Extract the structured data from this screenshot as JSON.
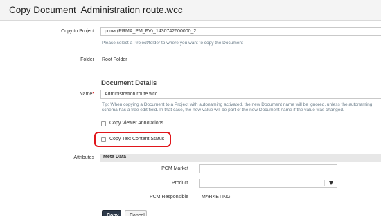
{
  "dialog": {
    "title": "Copy Document  Administration route.wcc"
  },
  "copy_to_project": {
    "label": "Copy to Project",
    "value": "prma (PRMA_PM_FV)_1430742600000_2",
    "hint": "Please select a Project/folder to where you want to copy the Document"
  },
  "folder": {
    "label": "Folder",
    "value": "Root Folder"
  },
  "document_details": {
    "title": "Document Details",
    "name_label": "Name",
    "required_mark": "*",
    "name_value": "Administration route.wcc",
    "tip_line1": "Tip: When copying a Document to a Project with autonaming activated, the new Document name will be ignored, unless the autonaming",
    "tip_line2": "schema has a free edit field. In that case, the new value will be part of the new Document name if the value was changed."
  },
  "options": {
    "copy_viewer_annotations": "Copy Viewer Annotations",
    "copy_text_content_status": "Copy Text Content Status"
  },
  "attributes": {
    "label": "Attributes",
    "meta_header": "Meta Data",
    "pcm_market_label": "PCM Market",
    "pcm_market_value": "",
    "product_label": "Product",
    "product_value": "",
    "pcm_responsible_label": "PCM Responsible",
    "pcm_responsible_value": "MARKETING"
  },
  "buttons": {
    "copy": "Copy",
    "cancel": "Cancel"
  },
  "colors": {
    "highlight": "#e0161b",
    "primary_button": "#2e3a4a",
    "hint_text": "#6b7d8a"
  }
}
